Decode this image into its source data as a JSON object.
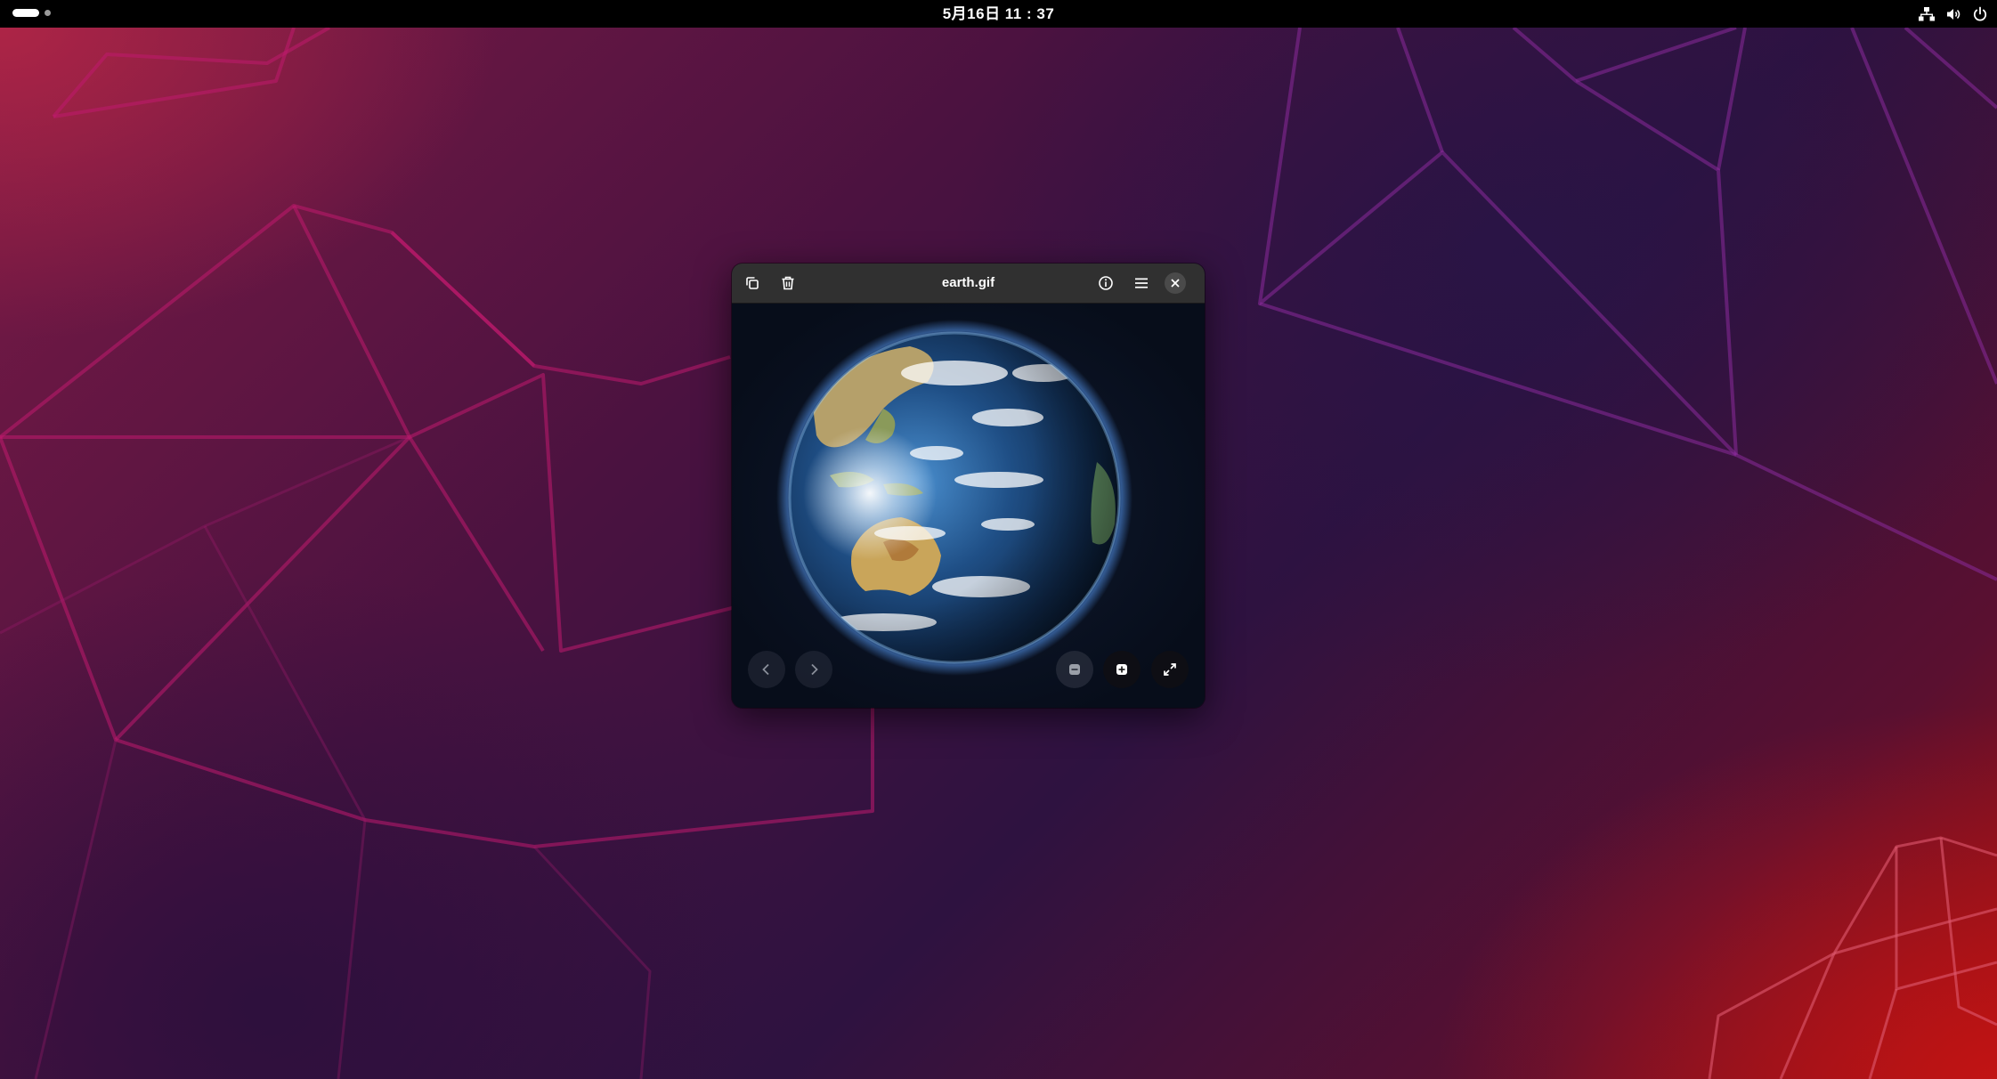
{
  "topbar": {
    "clock": "5月16日  11 : 37",
    "tray_icons": [
      "network-icon",
      "volume-icon",
      "power-icon"
    ]
  },
  "window": {
    "title": "earth.gif",
    "header_buttons": [
      "copy-icon",
      "trash-icon",
      "info-icon",
      "hamburger-menu-icon",
      "close-icon"
    ],
    "image_alt": "earth"
  },
  "controls": {
    "nav": [
      "chevron-left-icon",
      "chevron-right-icon"
    ],
    "zoom": [
      "zoom-out-icon",
      "zoom-in-icon",
      "fullscreen-icon"
    ]
  },
  "colors": {
    "topbar_bg": "#000000",
    "headerbar_bg": "#303030",
    "viewer_bg": "#0a1222",
    "wallpaper_line": "#c2185b"
  }
}
